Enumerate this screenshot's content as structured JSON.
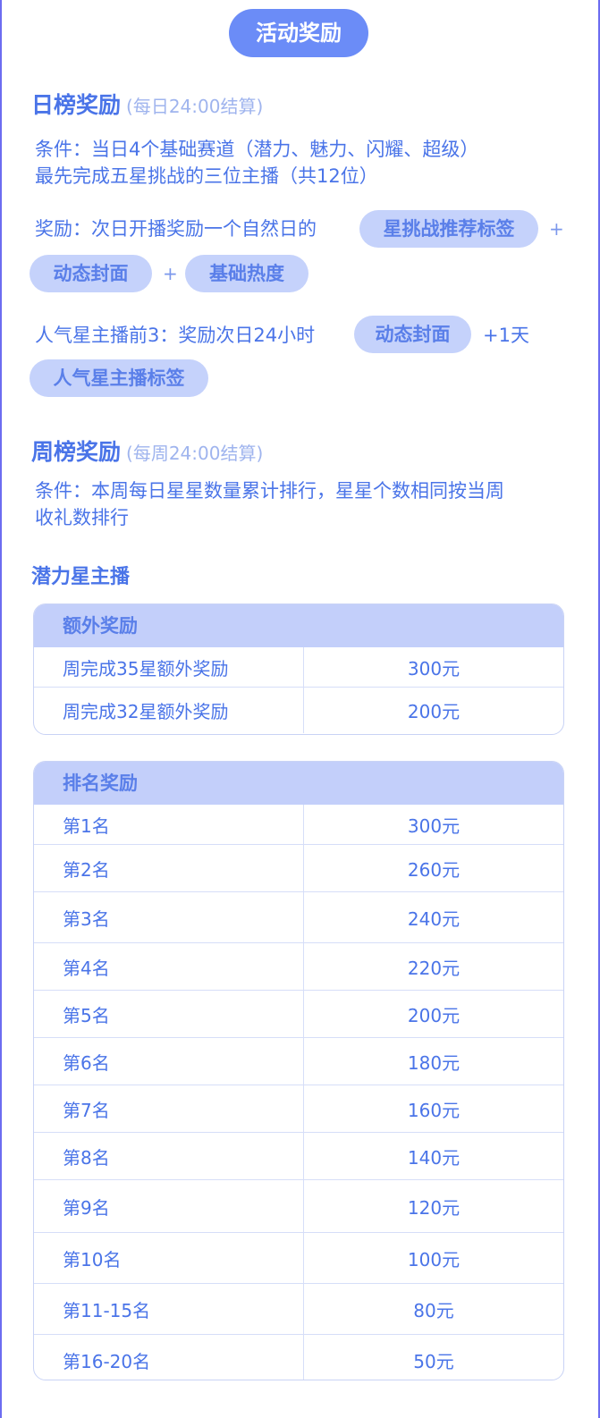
{
  "header": {
    "title": "活动奖励"
  },
  "daily": {
    "title": "日榜奖励",
    "settle": "(每日24:00结算)",
    "condition_line1": "条件：当日4个基础赛道（潜力、魅力、闪耀、超级）",
    "condition_line2": "最先完成五星挑战的三位主播（共12位）",
    "reward_prefix": "奖励：次日开播奖励一个自然日的",
    "tag_recommend": "星挑战推荐标签",
    "plus": "+",
    "tag_dynamic_cover": "动态封面",
    "tag_basic_heat": "基础热度",
    "popular_prefix": "人气星主播前3：奖励次日24小时",
    "tag_dynamic_cover_2": "动态封面",
    "popular_suffix": "+1天",
    "tag_popular_star": "人气星主播标签"
  },
  "weekly": {
    "title": "周榜奖励",
    "settle": "(每周24:00结算)",
    "condition_line1": "条件：本周每日星星数量累计排行，星星个数相同按当周",
    "condition_line2": "收礼数排行",
    "section_title": "潜力星主播"
  },
  "extra_table": {
    "header": "额外奖励",
    "rows": [
      {
        "label": "周完成35星额外奖励",
        "value": "300元"
      },
      {
        "label": "周完成32星额外奖励",
        "value": "200元"
      }
    ]
  },
  "rank_table": {
    "header": "排名奖励",
    "rows": [
      {
        "label": "第1名",
        "value": "300元"
      },
      {
        "label": "第2名",
        "value": "260元"
      },
      {
        "label": "第3名",
        "value": "240元"
      },
      {
        "label": "第4名",
        "value": "220元"
      },
      {
        "label": "第5名",
        "value": "200元"
      },
      {
        "label": "第6名",
        "value": "180元"
      },
      {
        "label": "第7名",
        "value": "160元"
      },
      {
        "label": "第8名",
        "value": "140元"
      },
      {
        "label": "第9名",
        "value": "120元"
      },
      {
        "label": "第10名",
        "value": "100元"
      },
      {
        "label": "第11-15名",
        "value": "80元"
      },
      {
        "label": "第16-20名",
        "value": "50元"
      }
    ]
  }
}
